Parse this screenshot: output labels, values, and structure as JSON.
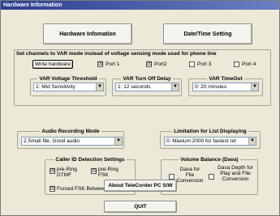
{
  "window": {
    "title": "Hardware Information"
  },
  "top_buttons": {
    "hardware_info": "Hardware Infomation",
    "date_time": "Date/Time Setting"
  },
  "var_mode": {
    "heading": "Set channels to VAR mode instead of voltage sensing mode used for phone line",
    "write_hardware": "Write hardware",
    "ports": [
      {
        "label": "Port 1",
        "checked": true,
        "mark": "☒"
      },
      {
        "label": "Port2",
        "checked": true,
        "mark": "☒"
      },
      {
        "label": "Port 3",
        "checked": false,
        "mark": ""
      },
      {
        "label": "Port 4",
        "checked": false,
        "mark": ""
      }
    ],
    "voltage_threshold": {
      "title": "VAR Voltage Threshold",
      "value": "2: Mid Sensitivity"
    },
    "turn_off_delay": {
      "title": "VAR Turn Off Delay",
      "value": "1: 12 seconds"
    },
    "timeout": {
      "title": "VAR TimeOut",
      "value": "0: 20 minutes"
    }
  },
  "audio": {
    "title": "Audio Recording Mode",
    "value": "2.Small file, Good audio"
  },
  "list_limit": {
    "title": "Limitation for List Displaying",
    "value": "0. Maxium 2000 for fastest ret"
  },
  "caller_id": {
    "title": "Caller ID Detection Settings",
    "pre_ring_dtmf": "pre-Ring DTMF",
    "pre_ring_fsk": "pre-Ring FSK",
    "forced_fsk": "Forced FSK Between Rings",
    "mark": "☒"
  },
  "volume": {
    "title": "Volume Balance (Dava)",
    "dava_conversion": "Dava for File Conversion",
    "dava_depth": "Dava Depth for Play and File Conversion"
  },
  "bottom_buttons": {
    "about": "About TeleCorder PC S/W",
    "quit": "QUIT"
  }
}
